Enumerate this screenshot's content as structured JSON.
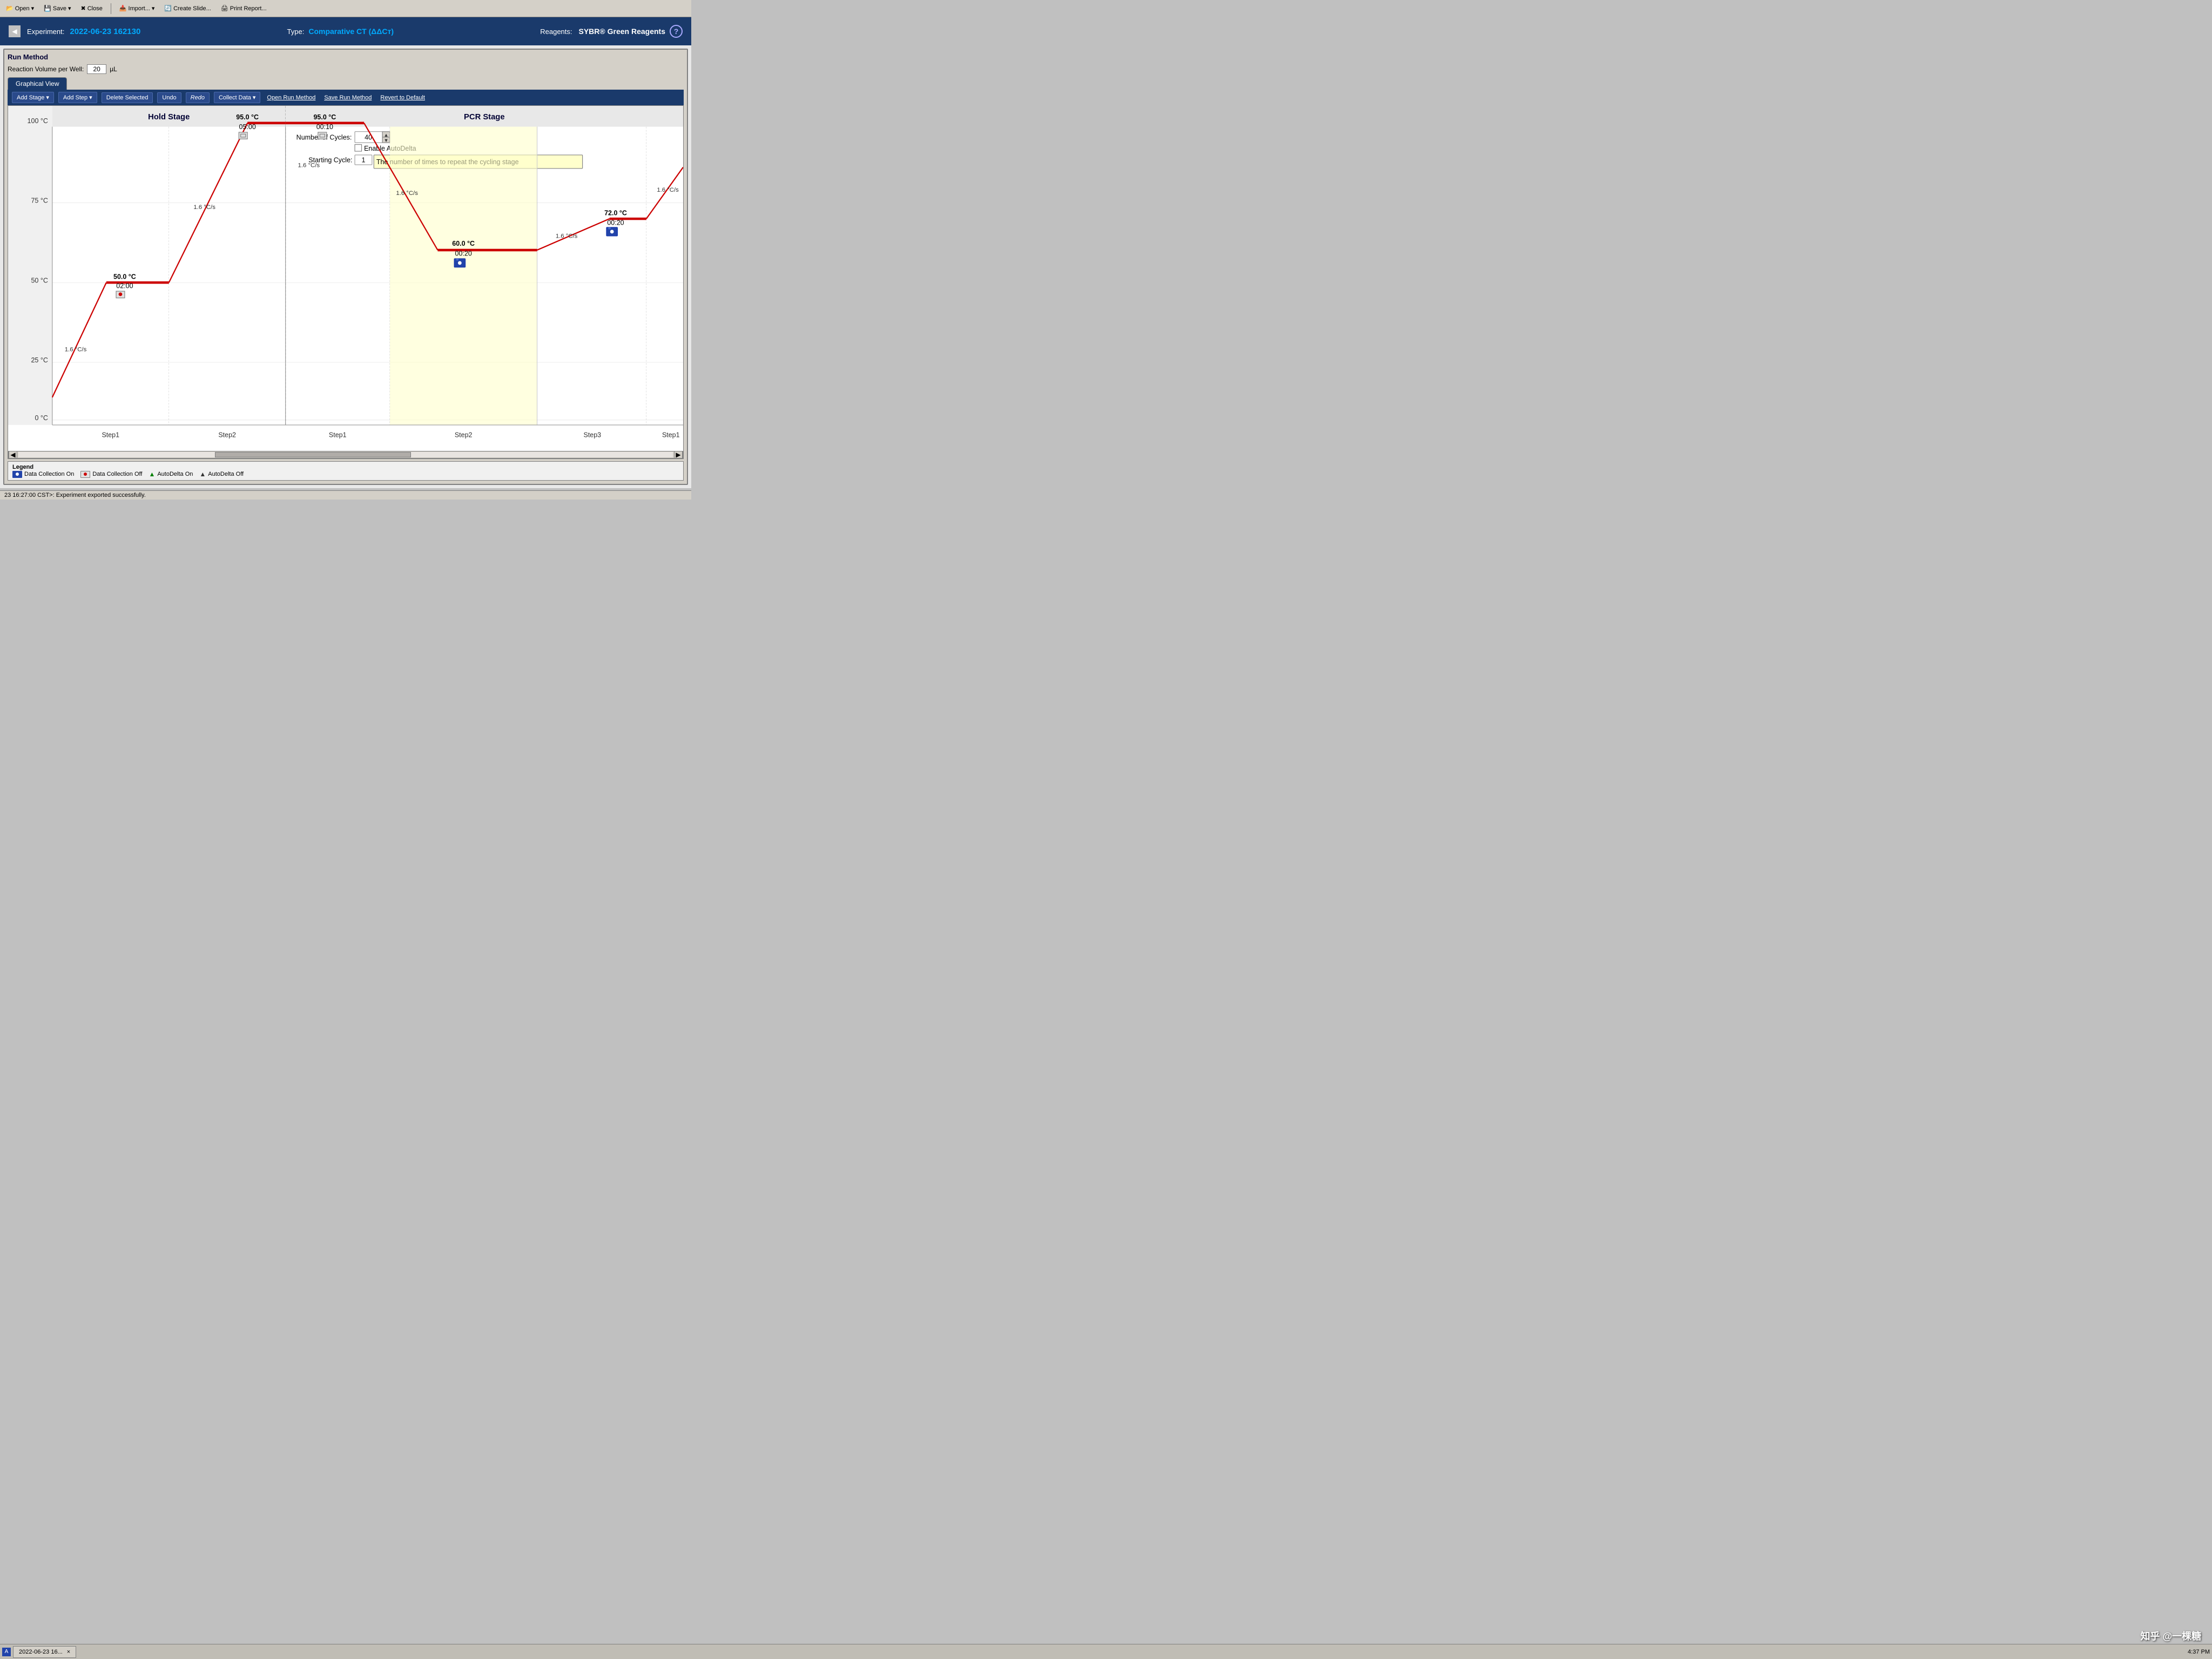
{
  "toolbar": {
    "open_label": "Open",
    "save_label": "Save",
    "close_label": "Close",
    "import_label": "Import...",
    "create_slide_label": "Create Slide...",
    "print_report_label": "Print Report..."
  },
  "header": {
    "experiment_label": "Experiment:",
    "experiment_value": "2022-06-23 162130",
    "type_label": "Type:",
    "type_value": "Comparative CT (ΔΔCт)",
    "reagents_label": "Reagents:",
    "reagents_value": "SYBR® Green Reagents",
    "help_label": "?"
  },
  "run_method": {
    "title": "Run Method",
    "reaction_volume_label": "Reaction Volume per Well:",
    "reaction_volume_value": "20",
    "reaction_volume_unit": "µL"
  },
  "tabs": {
    "graphical_view": "Graphical View"
  },
  "graph_toolbar": {
    "add_stage": "Add Stage",
    "add_step": "Add Step",
    "delete_selected": "Delete Selected",
    "undo": "Undo",
    "redo": "Redo",
    "collect_data": "Collect Data",
    "open_run_method": "Open Run Method",
    "save_run_method": "Save Run Method",
    "revert_to_default": "Revert to Default"
  },
  "hold_stage": {
    "title": "Hold Stage",
    "step1": {
      "temp": "50.0 °C",
      "time": "02:00",
      "ramp": "1.6 °C/s"
    },
    "step2": {
      "temp": "95.0 °C",
      "time": "05:00",
      "ramp": "1.6 °C/s"
    }
  },
  "pcr_stage": {
    "title": "PCR Stage",
    "cycles_label": "Number of Cycles:",
    "cycles_value": "40",
    "enable_autodelta": "Enable AutoDelta",
    "starting_cycle_label": "Starting Cycle:",
    "starting_cycle_value": "1",
    "tooltip": "The number of times to repeat the cycling stage",
    "step1": {
      "temp": "95.0 °C",
      "time": "00:10",
      "ramp": "1.6 °C/s"
    },
    "step2": {
      "temp": "60.0 °C",
      "time": "00:20",
      "ramp": "1.6 °C/s"
    },
    "step3": {
      "temp": "72.0 °C",
      "time": "00:20",
      "ramp": "1.6 °C/s"
    }
  },
  "y_axis": {
    "labels": [
      "100 °C",
      "75 °C",
      "50 °C",
      "25 °C",
      "0 °C"
    ]
  },
  "x_axis": {
    "hold_steps": [
      "Step1",
      "Step2"
    ],
    "pcr_steps": [
      "Step1",
      "Step2",
      "Step3",
      "Step1"
    ]
  },
  "legend": {
    "title": "Legend",
    "items": [
      {
        "icon": "camera-on",
        "label": "Data Collection On"
      },
      {
        "icon": "camera-off",
        "label": "Data Collection Off"
      },
      {
        "icon": "triangle-on",
        "label": "AutoDelta On"
      },
      {
        "icon": "triangle-off",
        "label": "AutoDelta Off"
      }
    ]
  },
  "status": {
    "message": "23 16:27:00 CST>: Experiment exported successfully.",
    "time": "4:37 PM"
  },
  "taskbar": {
    "tab_label": "2022-06-23 16...",
    "close_label": "×"
  }
}
